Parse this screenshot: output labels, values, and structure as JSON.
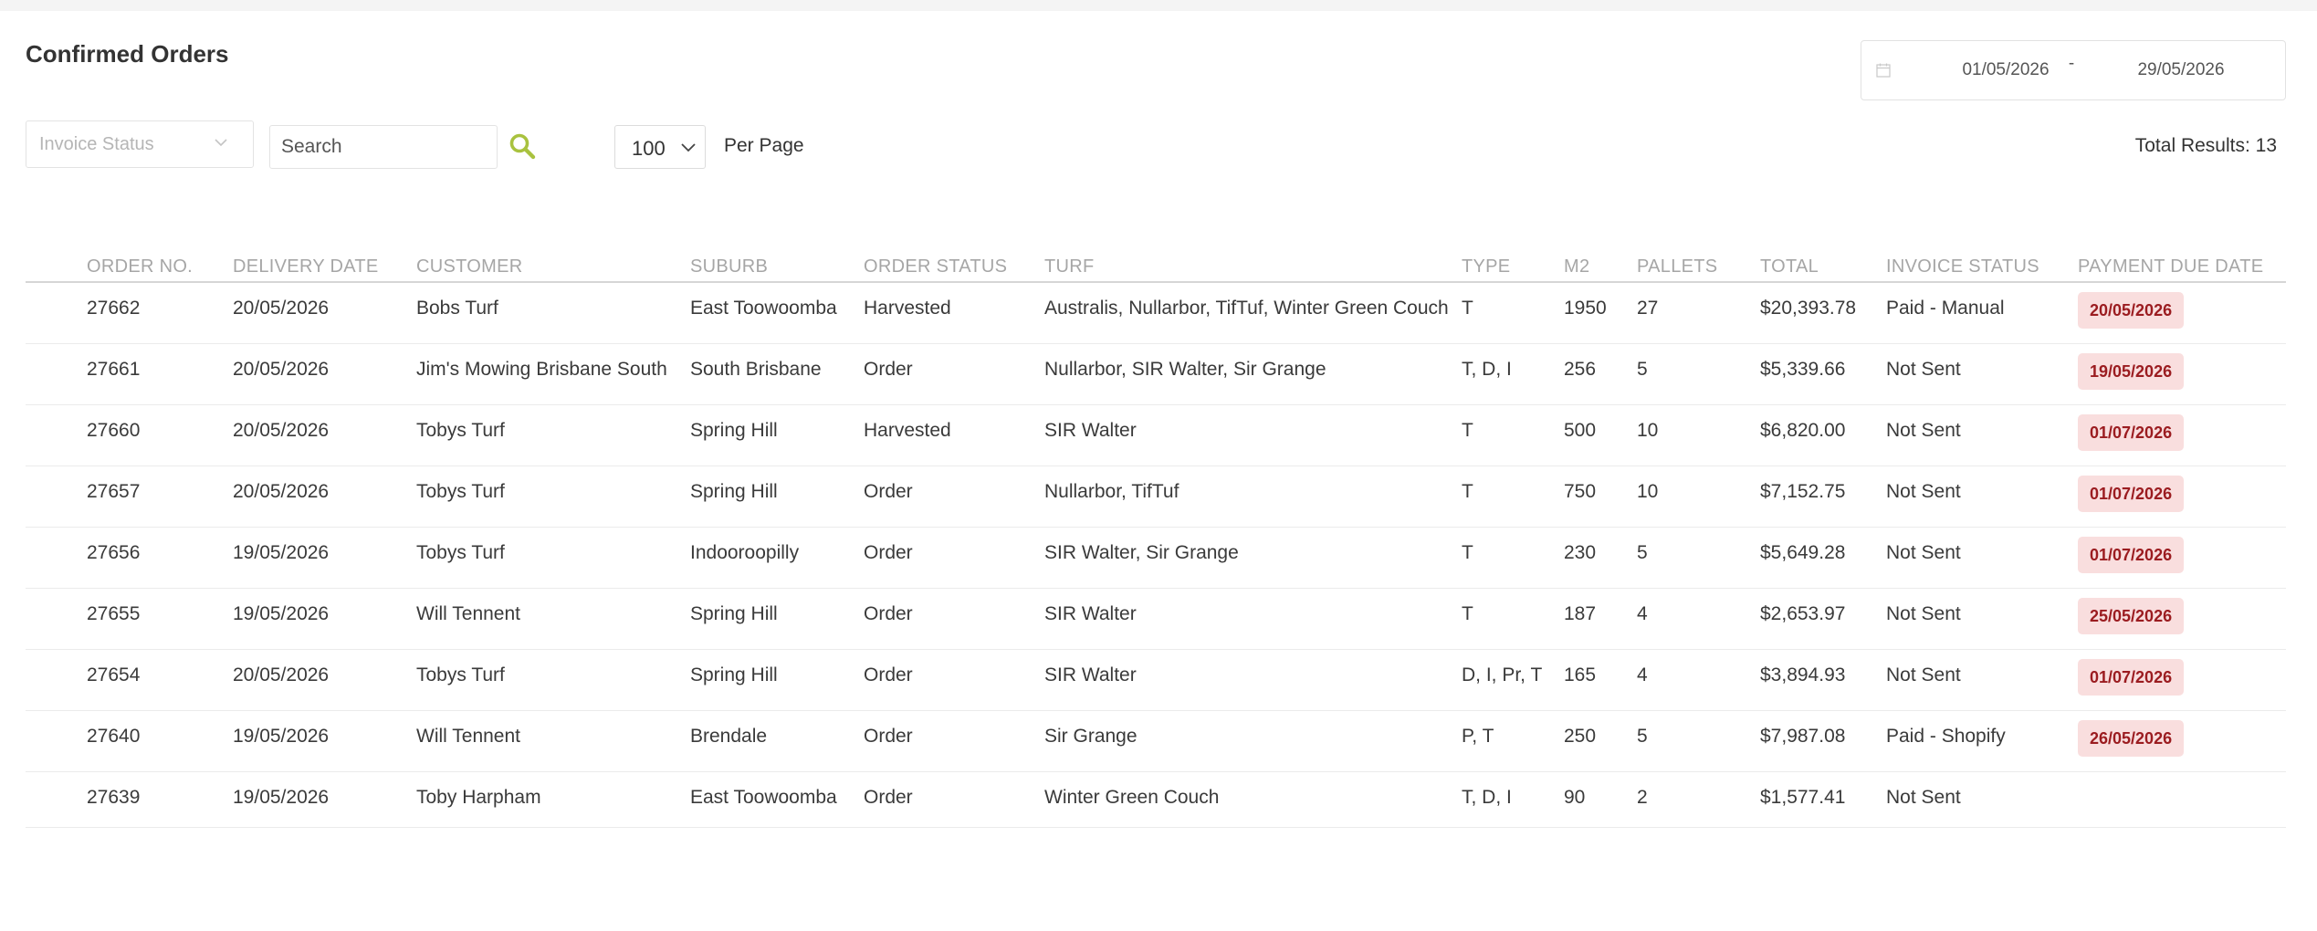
{
  "page": {
    "title": "Confirmed Orders"
  },
  "date_range": {
    "from": "01/05/2026",
    "separator": "-",
    "to": "29/05/2026"
  },
  "filters": {
    "invoice_status_placeholder": "Invoice Status",
    "search_placeholder": "Search",
    "per_page_value": "100",
    "per_page_label": "Per Page"
  },
  "total_results": "Total Results: 13",
  "colors": {
    "accent": "#a9c23f",
    "badge_bg": "#f9dede",
    "badge_text": "#9b1c20"
  },
  "table": {
    "columns": [
      {
        "key": "order_no",
        "label": "ORDER NO."
      },
      {
        "key": "delivery_date",
        "label": "DELIVERY DATE"
      },
      {
        "key": "customer",
        "label": "CUSTOMER"
      },
      {
        "key": "suburb",
        "label": "SUBURB"
      },
      {
        "key": "order_status",
        "label": "ORDER STATUS"
      },
      {
        "key": "turf",
        "label": "TURF"
      },
      {
        "key": "type",
        "label": "TYPE"
      },
      {
        "key": "m2",
        "label": "M2"
      },
      {
        "key": "pallets",
        "label": "PALLETS"
      },
      {
        "key": "total",
        "label": "TOTAL"
      },
      {
        "key": "invoice_status",
        "label": "INVOICE STATUS"
      },
      {
        "key": "payment_due",
        "label": "PAYMENT DUE DATE"
      }
    ],
    "rows": [
      {
        "order_no": "27662",
        "delivery_date": "20/05/2026",
        "customer": "Bobs Turf",
        "suburb": "East Toowoomba",
        "order_status": "Harvested",
        "turf": "Australis, Nullarbor, TifTuf, Winter Green Couch",
        "type": "T",
        "m2": "1950",
        "pallets": "27",
        "total": "$20,393.78",
        "invoice_status": "Paid - Manual",
        "payment_due": "20/05/2026"
      },
      {
        "order_no": "27661",
        "delivery_date": "20/05/2026",
        "customer": "Jim's Mowing Brisbane South",
        "suburb": "South Brisbane",
        "order_status": "Order",
        "turf": "Nullarbor, SIR Walter, Sir Grange",
        "type": "T, D, I",
        "m2": "256",
        "pallets": "5",
        "total": "$5,339.66",
        "invoice_status": "Not Sent",
        "payment_due": "19/05/2026"
      },
      {
        "order_no": "27660",
        "delivery_date": "20/05/2026",
        "customer": "Tobys Turf",
        "suburb": "Spring Hill",
        "order_status": "Harvested",
        "turf": "SIR Walter",
        "type": "T",
        "m2": "500",
        "pallets": "10",
        "total": "$6,820.00",
        "invoice_status": "Not Sent",
        "payment_due": "01/07/2026"
      },
      {
        "order_no": "27657",
        "delivery_date": "20/05/2026",
        "customer": "Tobys Turf",
        "suburb": "Spring Hill",
        "order_status": "Order",
        "turf": "Nullarbor, TifTuf",
        "type": "T",
        "m2": "750",
        "pallets": "10",
        "total": "$7,152.75",
        "invoice_status": "Not Sent",
        "payment_due": "01/07/2026"
      },
      {
        "order_no": "27656",
        "delivery_date": "19/05/2026",
        "customer": "Tobys Turf",
        "suburb": "Indooroopilly",
        "order_status": "Order",
        "turf": "SIR Walter, Sir Grange",
        "type": "T",
        "m2": "230",
        "pallets": "5",
        "total": "$5,649.28",
        "invoice_status": "Not Sent",
        "payment_due": "01/07/2026"
      },
      {
        "order_no": "27655",
        "delivery_date": "19/05/2026",
        "customer": "Will Tennent",
        "suburb": "Spring Hill",
        "order_status": "Order",
        "turf": "SIR Walter",
        "type": "T",
        "m2": "187",
        "pallets": "4",
        "total": "$2,653.97",
        "invoice_status": "Not Sent",
        "payment_due": "25/05/2026"
      },
      {
        "order_no": "27654",
        "delivery_date": "20/05/2026",
        "customer": "Tobys Turf",
        "suburb": "Spring Hill",
        "order_status": "Order",
        "turf": "SIR Walter",
        "type": "D, I, Pr, T",
        "m2": "165",
        "pallets": "4",
        "total": "$3,894.93",
        "invoice_status": "Not Sent",
        "payment_due": "01/07/2026"
      },
      {
        "order_no": "27640",
        "delivery_date": "19/05/2026",
        "customer": "Will Tennent",
        "suburb": "Brendale",
        "order_status": "Order",
        "turf": "Sir Grange",
        "type": "P, T",
        "m2": "250",
        "pallets": "5",
        "total": "$7,987.08",
        "invoice_status": "Paid - Shopify",
        "payment_due": "26/05/2026"
      },
      {
        "order_no": "27639",
        "delivery_date": "19/05/2026",
        "customer": "Toby Harpham",
        "suburb": "East Toowoomba",
        "order_status": "Order",
        "turf": "Winter Green Couch",
        "type": "T, D, I",
        "m2": "90",
        "pallets": "2",
        "total": "$1,577.41",
        "invoice_status": "Not Sent",
        "payment_due": ""
      }
    ]
  }
}
